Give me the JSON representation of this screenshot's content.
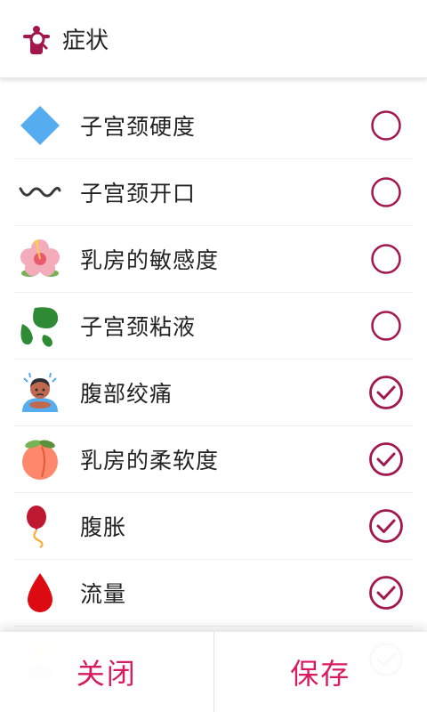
{
  "header": {
    "title": "症状",
    "icon": "symptom-search-icon"
  },
  "accent_color": "#a3174f",
  "symptoms": [
    {
      "label": "子宫颈硬度",
      "icon": "blue-diamond-icon",
      "checked": false
    },
    {
      "label": "子宫颈开口",
      "icon": "wavy-line-icon",
      "checked": false
    },
    {
      "label": "乳房的敏感度",
      "icon": "hibiscus-icon",
      "checked": false
    },
    {
      "label": "子宫颈粘液",
      "icon": "droplets-icon",
      "checked": false
    },
    {
      "label": "腹部绞痛",
      "icon": "person-in-pain-icon",
      "checked": true
    },
    {
      "label": "乳房的柔软度",
      "icon": "peach-icon",
      "checked": true
    },
    {
      "label": "腹胀",
      "icon": "balloon-icon",
      "checked": true
    },
    {
      "label": "流量",
      "icon": "blood-drop-icon",
      "checked": true
    }
  ],
  "footer": {
    "close_label": "关闭",
    "save_label": "保存"
  }
}
